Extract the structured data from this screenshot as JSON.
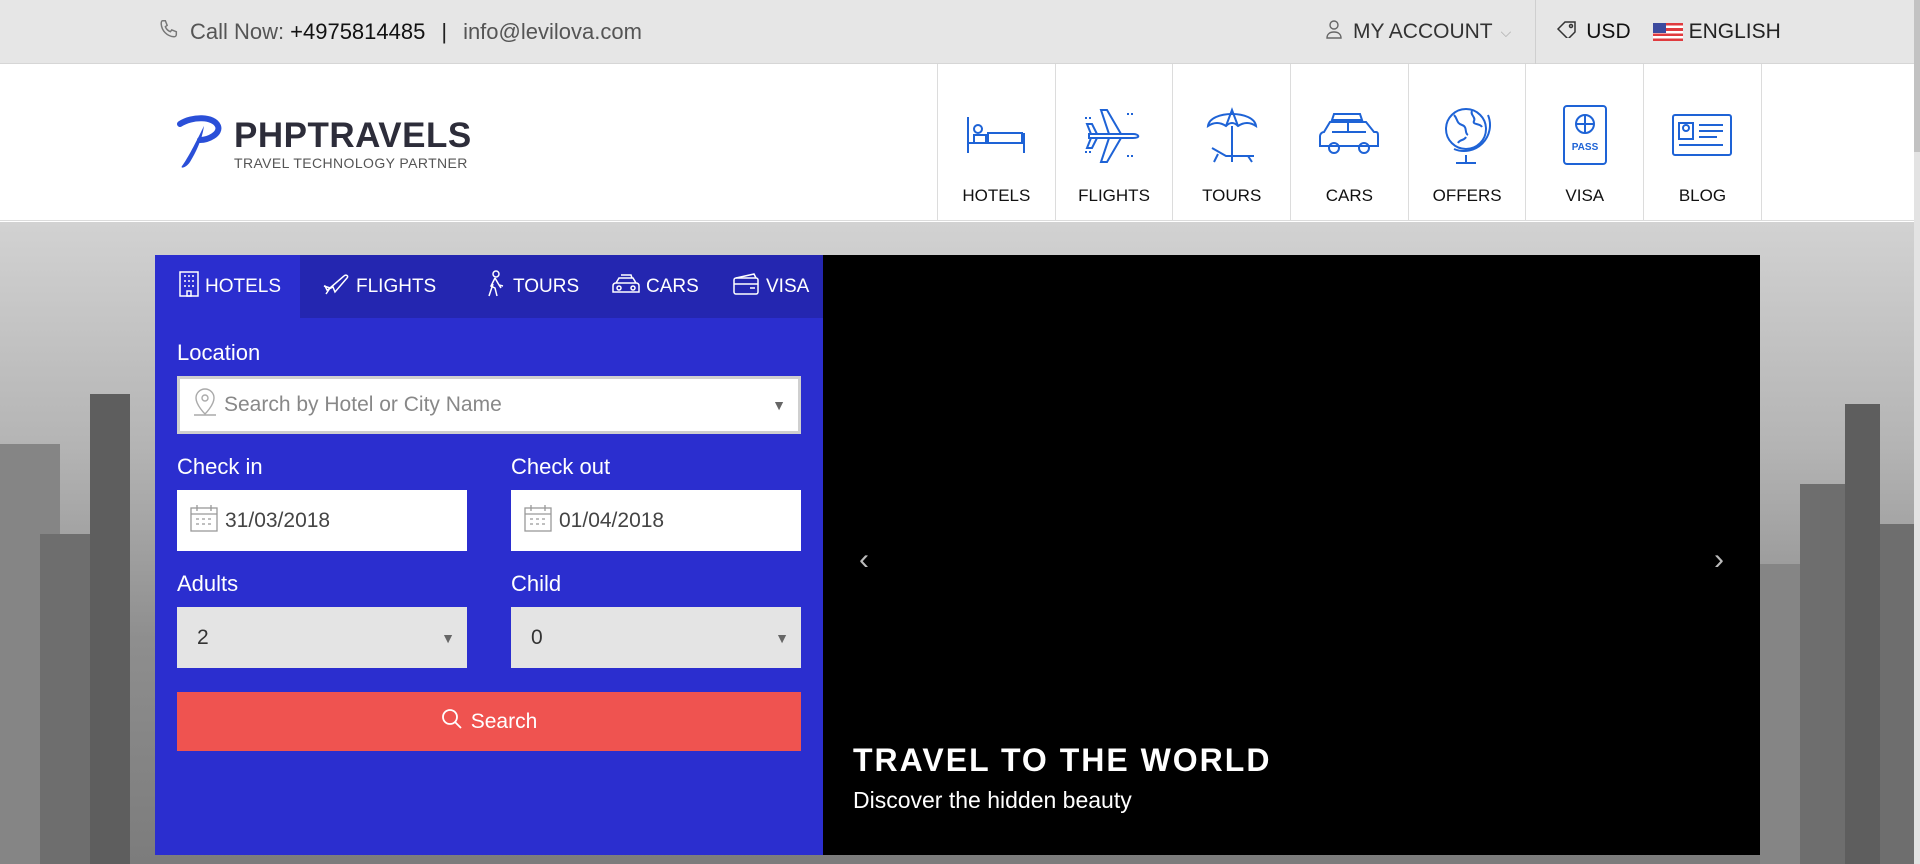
{
  "topbar": {
    "call_label": "Call Now:",
    "phone": "+4975814485",
    "separator": "|",
    "email": "info@levilova.com",
    "account_label": "MY ACCOUNT",
    "currency": "USD",
    "language": "ENGLISH"
  },
  "brand": {
    "name": "PHPTRAVELS",
    "tagline": "TRAVEL TECHNOLOGY PARTNER"
  },
  "main_nav": [
    {
      "label": "HOTELS",
      "icon": "bed-icon"
    },
    {
      "label": "FLIGHTS",
      "icon": "plane-icon"
    },
    {
      "label": "TOURS",
      "icon": "beach-umbrella-icon"
    },
    {
      "label": "CARS",
      "icon": "car-icon"
    },
    {
      "label": "OFFERS",
      "icon": "globe-icon"
    },
    {
      "label": "VISA",
      "icon": "passport-icon"
    },
    {
      "label": "BLOG",
      "icon": "id-card-icon"
    }
  ],
  "search": {
    "tabs": [
      {
        "label": "HOTELS",
        "icon": "building-icon"
      },
      {
        "label": "FLIGHTS",
        "icon": "plane-icon"
      },
      {
        "label": "TOURS",
        "icon": "hiker-icon"
      },
      {
        "label": "CARS",
        "icon": "car-icon"
      },
      {
        "label": "VISA",
        "icon": "card-icon"
      }
    ],
    "active_tab": "HOTELS",
    "location_label": "Location",
    "location_placeholder": "Search by Hotel or City Name",
    "checkin_label": "Check in",
    "checkin_value": "31/03/2018",
    "checkout_label": "Check out",
    "checkout_value": "01/04/2018",
    "adults_label": "Adults",
    "adults_value": "2",
    "child_label": "Child",
    "child_value": "0",
    "button_label": "Search"
  },
  "slider": {
    "title": "TRAVEL TO THE WORLD",
    "subtitle": "Discover the hidden beauty",
    "prev": "‹",
    "next": "›"
  },
  "colors": {
    "panel": "#2b2ecf",
    "tabs_bar": "#2426b0",
    "search_button": "#ef5350",
    "nav_icon": "#1e63d6"
  }
}
